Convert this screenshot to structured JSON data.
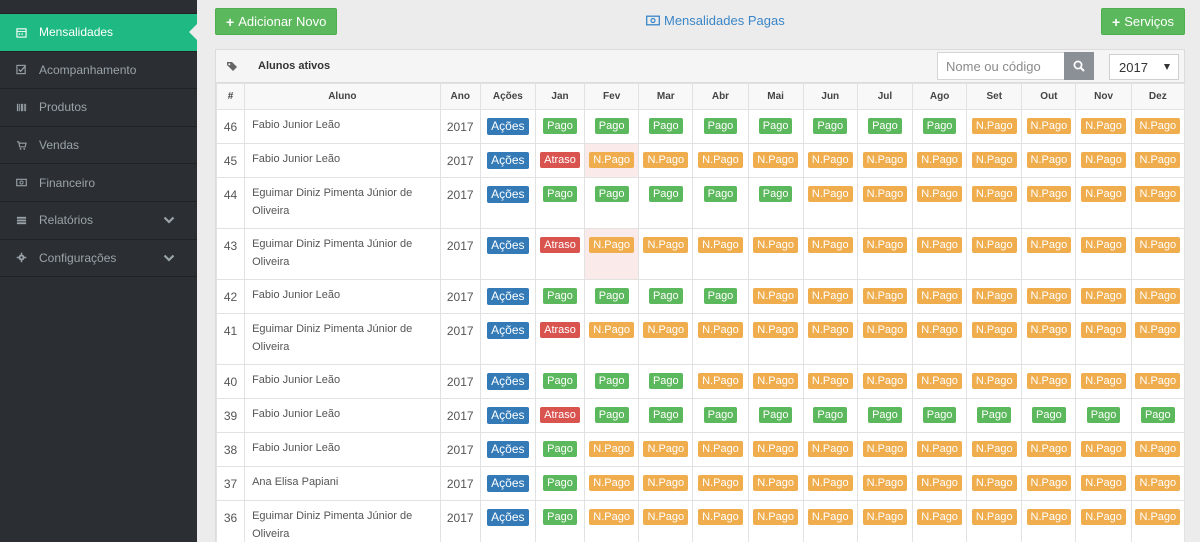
{
  "sidebar": {
    "items": [
      {
        "label": "Mensalidades",
        "icon": "calendar-icon",
        "active": true
      },
      {
        "label": "Acompanhamento",
        "icon": "check-square-icon"
      },
      {
        "label": "Produtos",
        "icon": "barcode-icon"
      },
      {
        "label": "Vendas",
        "icon": "cart-icon"
      },
      {
        "label": "Financeiro",
        "icon": "money-icon"
      },
      {
        "label": "Relatórios",
        "icon": "list-icon",
        "expandable": true
      },
      {
        "label": "Configurações",
        "icon": "gear-icon",
        "expandable": true
      }
    ]
  },
  "toolbar": {
    "add_label": "Adicionar Novo",
    "paid_link_label": "Mensalidades Pagas",
    "services_label": "Serviços"
  },
  "panel": {
    "title": "Alunos ativos",
    "search_placeholder": "Nome ou código",
    "year_selected": "2017"
  },
  "table": {
    "headers": [
      "#",
      "Aluno",
      "Ano",
      "Ações",
      "Jan",
      "Fev",
      "Mar",
      "Abr",
      "Mai",
      "Jun",
      "Jul",
      "Ago",
      "Set",
      "Out",
      "Nov",
      "Dez"
    ],
    "action_label": "Ações",
    "status_labels": {
      "P": "Pago",
      "N": "N.Pago",
      "A": "Atraso"
    },
    "rows": [
      {
        "id": "46",
        "name": "Fabio Junior Leão",
        "year": "2017",
        "months": [
          "P",
          "P",
          "P",
          "P",
          "P",
          "P",
          "P",
          "P",
          "N",
          "N",
          "N",
          "N"
        ]
      },
      {
        "id": "45",
        "name": "Fabio Junior Leão",
        "year": "2017",
        "months": [
          "A",
          "N",
          "N",
          "N",
          "N",
          "N",
          "N",
          "N",
          "N",
          "N",
          "N",
          "N"
        ],
        "highlight": 1
      },
      {
        "id": "44",
        "name": "Eguimar Diniz Pimenta Júnior de Oliveira",
        "year": "2017",
        "months": [
          "P",
          "P",
          "P",
          "P",
          "P",
          "N",
          "N",
          "N",
          "N",
          "N",
          "N",
          "N"
        ]
      },
      {
        "id": "43",
        "name": "Eguimar Diniz Pimenta Júnior de Oliveira",
        "year": "2017",
        "months": [
          "A",
          "N",
          "N",
          "N",
          "N",
          "N",
          "N",
          "N",
          "N",
          "N",
          "N",
          "N"
        ],
        "highlight": 1
      },
      {
        "id": "42",
        "name": "Fabio Junior Leão",
        "year": "2017",
        "months": [
          "P",
          "P",
          "P",
          "P",
          "N",
          "N",
          "N",
          "N",
          "N",
          "N",
          "N",
          "N"
        ]
      },
      {
        "id": "41",
        "name": "Eguimar Diniz Pimenta Júnior de Oliveira",
        "year": "2017",
        "months": [
          "A",
          "N",
          "N",
          "N",
          "N",
          "N",
          "N",
          "N",
          "N",
          "N",
          "N",
          "N"
        ]
      },
      {
        "id": "40",
        "name": "Fabio Junior Leão",
        "year": "2017",
        "months": [
          "P",
          "P",
          "P",
          "N",
          "N",
          "N",
          "N",
          "N",
          "N",
          "N",
          "N",
          "N"
        ]
      },
      {
        "id": "39",
        "name": "Fabio Junior Leão",
        "year": "2017",
        "months": [
          "A",
          "P",
          "P",
          "P",
          "P",
          "P",
          "P",
          "P",
          "P",
          "P",
          "P",
          "P"
        ]
      },
      {
        "id": "38",
        "name": "Fabio Junior Leão",
        "year": "2017",
        "months": [
          "P",
          "N",
          "N",
          "N",
          "N",
          "N",
          "N",
          "N",
          "N",
          "N",
          "N",
          "N"
        ]
      },
      {
        "id": "37",
        "name": "Ana Elisa Papiani",
        "year": "2017",
        "months": [
          "P",
          "N",
          "N",
          "N",
          "N",
          "N",
          "N",
          "N",
          "N",
          "N",
          "N",
          "N"
        ]
      },
      {
        "id": "36",
        "name": "Eguimar Diniz Pimenta Júnior de Oliveira",
        "year": "2017",
        "months": [
          "P",
          "N",
          "N",
          "N",
          "N",
          "N",
          "N",
          "N",
          "N",
          "N",
          "N",
          "N"
        ]
      }
    ]
  },
  "colors": {
    "sidebar_bg": "#2b2f33",
    "active": "#1fb984",
    "pago": "#5cb85c",
    "npago": "#f0ad4e",
    "atraso": "#d9534f",
    "acoes": "#337ab7"
  }
}
